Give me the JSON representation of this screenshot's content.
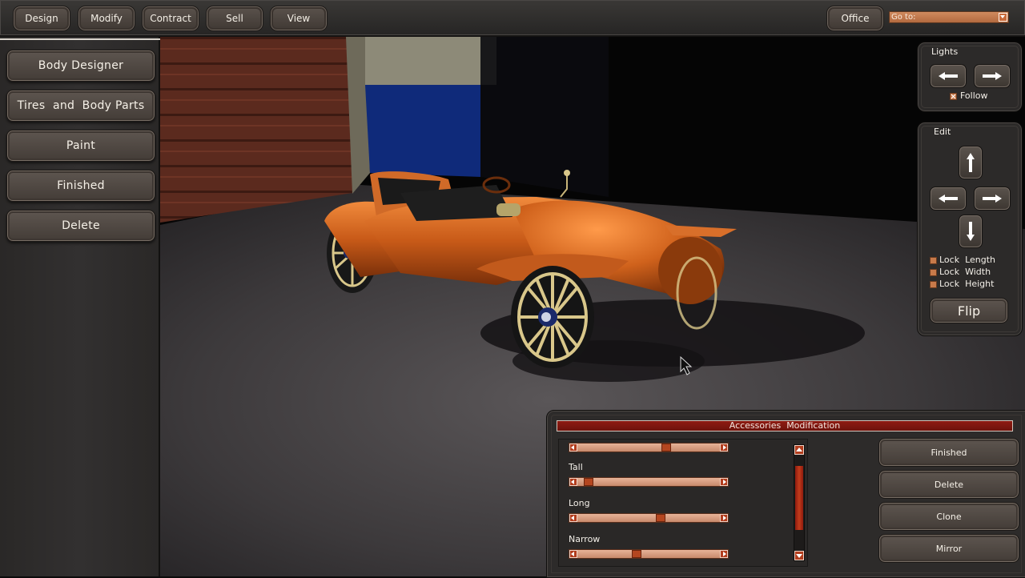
{
  "toolbar": {
    "design": "Design",
    "modify": "Modify",
    "contract": "Contract",
    "sell": "Sell",
    "view": "View",
    "office": "Office",
    "goto_label": "Go to:"
  },
  "sidebar": {
    "items": [
      {
        "label": "Body Designer"
      },
      {
        "label": "Tires  and  Body Parts"
      },
      {
        "label": "Paint"
      },
      {
        "label": "Finished"
      },
      {
        "label": "Delete"
      }
    ]
  },
  "lights": {
    "title": "Lights",
    "follow_label": "Follow"
  },
  "edit": {
    "title": "Edit",
    "lock_length": "Lock  Length",
    "lock_width": "Lock  Width",
    "lock_height": "Lock  Height",
    "flip_label": "Flip"
  },
  "accessories": {
    "title": "Accessories  Modification",
    "sliders": [
      {
        "label": "",
        "value": 0.63
      },
      {
        "label": "Tall",
        "value": 0.05
      },
      {
        "label": "Long",
        "value": 0.59
      },
      {
        "label": "Narrow",
        "value": 0.41
      }
    ],
    "scroll_position": 0.35,
    "finished_label": "Finished",
    "delete_label": "Delete",
    "clone_label": "Clone",
    "mirror_label": "Mirror"
  },
  "colors": {
    "car_body": "#c85a18",
    "wheel_spoke": "#d9c78a",
    "accent_red": "#8e1b12"
  }
}
